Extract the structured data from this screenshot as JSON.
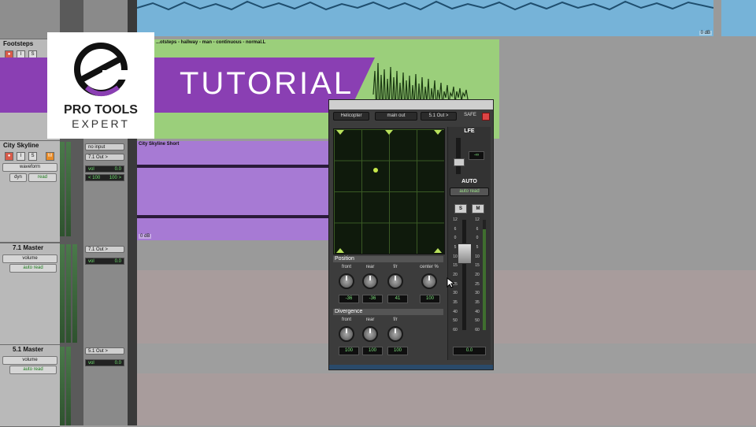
{
  "tracks": [
    {
      "name": "Footsteps"
    },
    {
      "name": "City Skyline",
      "view": "waveform",
      "dyn_label": "dyn",
      "automation": "read",
      "input": "no input",
      "output": "7.1 Out >",
      "vol_label": "vol",
      "vol_value": "0.0",
      "pan_left": "< 100",
      "pan_right": "100 >"
    },
    {
      "name": "7.1 Master",
      "view": "volume",
      "automation": "auto read",
      "output": "7.1 Out >",
      "vol_label": "vol",
      "vol_value": "0.0"
    },
    {
      "name": "5.1 Master",
      "view": "volume",
      "automation": "auto read",
      "output": "5.1 Out >",
      "vol_label": "vol",
      "vol_value": "0.0"
    }
  ],
  "record_buttons": {
    "rec": "●",
    "input": "I",
    "solo": "S",
    "mute": "M"
  },
  "clips": {
    "footsteps_title": "...otsteps - hallway - man - continuous - normal.L",
    "city_title": "City Skyline Short",
    "city_gain": "0 dB",
    "top_gain": "0 dB"
  },
  "banner": {
    "text": "TUTORIAL",
    "logo_line1": "PRO TOOLS",
    "logo_line2": "EXPERT",
    "color": "#8a3fb3"
  },
  "plugin": {
    "track": "Helicopter",
    "output": "main out",
    "format": "5.1 Out >",
    "safe": "SAFE",
    "lfe_label": "LFE",
    "lfe_value": "-∞",
    "auto_label": "AUTO",
    "auto_mode": "auto read",
    "solo": "S",
    "mute": "M",
    "fader_value": "0.0",
    "position_label": "Position",
    "position_knobs": [
      {
        "label": "front",
        "value": "-36"
      },
      {
        "label": "rear",
        "value": "-36"
      },
      {
        "label": "f/r",
        "value": "41"
      },
      {
        "label": "center %",
        "value": "100"
      }
    ],
    "divergence_label": "Divergence",
    "divergence_knobs": [
      {
        "label": "front",
        "value": "100"
      },
      {
        "label": "rear",
        "value": "100"
      },
      {
        "label": "f/r",
        "value": "100"
      }
    ],
    "scale": [
      "12",
      "6",
      "0",
      "5",
      "10",
      "15",
      "20",
      "25",
      "30",
      "35",
      "40",
      "50",
      "60"
    ],
    "fader_scale": [
      "12",
      "6",
      "0",
      "5",
      "10",
      "15",
      "20",
      "25",
      "30",
      "35",
      "40",
      "50",
      "60"
    ]
  },
  "colors": {
    "green_clip": "#9bcf7b",
    "blue_clip": "#76b3d8",
    "purple_clip": "#a77ad4",
    "accent": "#8a3fb3"
  }
}
